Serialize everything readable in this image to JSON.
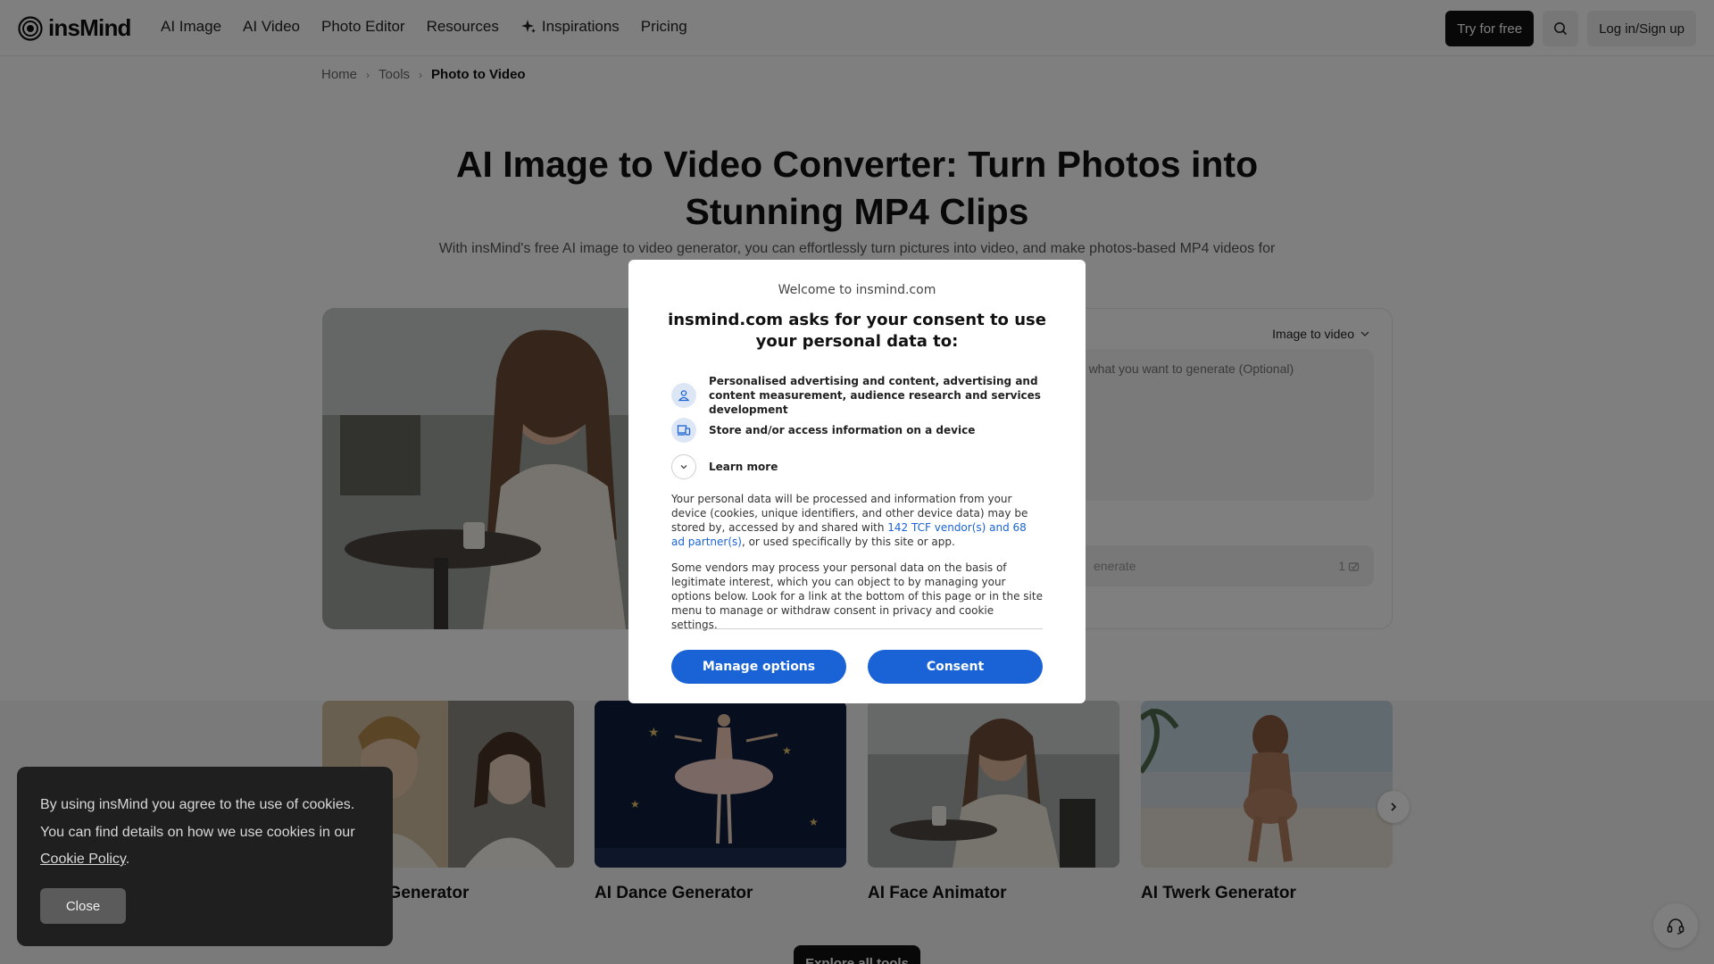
{
  "header": {
    "logo_text": "insMind",
    "nav": [
      "AI Image",
      "AI Video",
      "Photo Editor",
      "Resources",
      "Inspirations",
      "Pricing"
    ],
    "try_label": "Try for free",
    "login_label": "Log in/Sign up"
  },
  "breadcrumb": {
    "home": "Home",
    "tools": "Tools",
    "current": "Photo to Video"
  },
  "hero": {
    "title": "AI Image to Video Converter: Turn Photos into Stunning MP4 Clips",
    "subtitle": "With insMind's free AI image to video generator, you can effortlessly turn pictures into video, and make photos-based MP4 videos for"
  },
  "panel": {
    "mode": "Image to video",
    "prompt_placeholder": "ibe what you want to generate (Optional)",
    "generate_label": "enerate",
    "credits": "1"
  },
  "cards": [
    {
      "title": "g Video Generator"
    },
    {
      "title": "AI Dance Generator"
    },
    {
      "title": "AI Face Animator"
    },
    {
      "title": "AI Twerk Generator"
    }
  ],
  "explore_label": "Explore all tools",
  "consent": {
    "welcome": "Welcome to insmind.com",
    "heading": "insmind.com asks for your consent to use your personal data to:",
    "purposes": [
      "Personalised advertising and content, advertising and content measurement, audience research and services development",
      "Store and/or access information on a device"
    ],
    "learn_more": "Learn more",
    "body1_before": "Your personal data will be processed and information from your device (cookies, unique identifiers, and other device data) may be stored by, accessed by and shared with ",
    "body1_link": "142 TCF vendor(s) and 68 ad partner(s)",
    "body1_after": ", or used specifically by this site or app.",
    "body2": "Some vendors may process your personal data on the basis of legitimate interest, which you can object to by managing your options below. Look for a link at the bottom of this page or in the site menu to manage or withdraw consent in privacy and cookie settings.",
    "manage_label": "Manage options",
    "consent_label": "Consent"
  },
  "cookie": {
    "text": "By using insMind you agree to the use of cookies. You can find details on how we use cookies in our ",
    "link": "Cookie Policy",
    "end": ".",
    "close_label": "Close"
  }
}
